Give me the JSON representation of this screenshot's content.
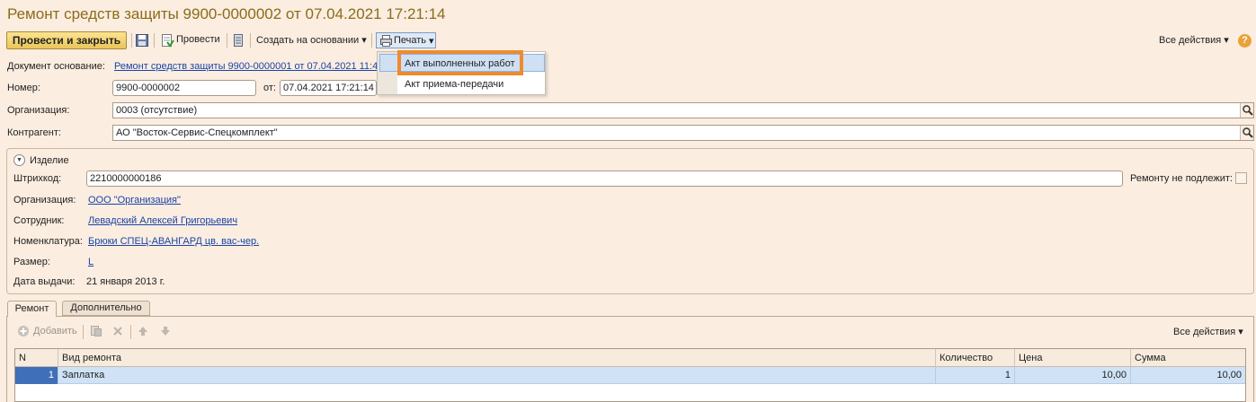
{
  "title": "Ремонт средств защиты 9900-0000002 от 07.04.2021 17:21:14",
  "toolbar": {
    "post_close": "Провести и закрыть",
    "post": "Провести",
    "create_based": "Создать на основании",
    "print": "Печать",
    "all_actions": "Все действия",
    "help": "?"
  },
  "print_menu": {
    "items": [
      "Акт выполненных работ",
      "Акт приема-передачи"
    ]
  },
  "header": {
    "base_doc_label": "Документ основание:",
    "base_doc_value": "Ремонт средств защиты 9900-0000001 от 07.04.2021 11:4",
    "number_label": "Номер:",
    "number_value": "9900-0000002",
    "date_label": "от:",
    "date_value": "07.04.2021 17:21:14",
    "org_label": "Организация:",
    "org_value": "0003 (отсутствие)",
    "contractor_label": "Контрагент:",
    "contractor_value": "АО \"Восток-Сервис-Спецкомплект\""
  },
  "item_group": {
    "title": "Изделие",
    "barcode_label": "Штрихкод:",
    "barcode_value": "2210000000186",
    "no_repair_label": "Ремонту не подлежит:",
    "org_label": "Организация:",
    "org_value": "ООО \"Организация\"",
    "employee_label": "Сотрудник:",
    "employee_value": "Левадский Алексей Григорьевич",
    "nomenclature_label": "Номенклатура:",
    "nomenclature_value": "Брюки СПЕЦ-АВАНГАРД цв. вас-чер.",
    "size_label": "Размер:",
    "size_value": "L",
    "issue_date_label": "Дата выдачи:",
    "issue_date_value": "21 января 2013 г."
  },
  "tabs": [
    "Ремонт",
    "Дополнительно"
  ],
  "table_toolbar": {
    "add": "Добавить",
    "all_actions": "Все действия"
  },
  "table": {
    "columns": [
      "N",
      "Вид ремонта",
      "Количество",
      "Цена",
      "Сумма"
    ],
    "rows": [
      {
        "n": "1",
        "kind": "Заплатка",
        "qty": "1",
        "price": "10,00",
        "sum": "10,00"
      }
    ]
  }
}
